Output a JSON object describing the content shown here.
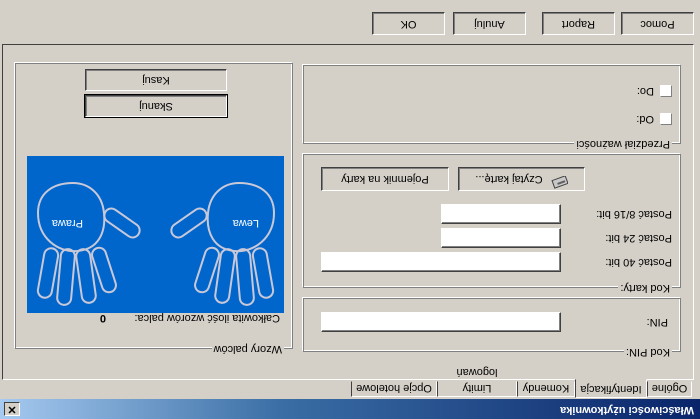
{
  "window": {
    "title": "Właściwości użytkownika",
    "close_glyph": "✕"
  },
  "tabs": [
    {
      "label": "Ogólne"
    },
    {
      "label": "Identyfikacja"
    },
    {
      "label": "Komendy"
    },
    {
      "label": "Limity logowań"
    },
    {
      "label": "Opcje hotelowe"
    }
  ],
  "active_tab": "Identyfikacja",
  "pin_group": {
    "label": "Kod PIN:",
    "pin_label": "PIN:",
    "pin_value": ""
  },
  "card_group": {
    "label": "Kod karty:",
    "bits40_label": "Postać 40 bit:",
    "bits24_label": "Postać 24 bit:",
    "bits816_label": "Postać 8/16 bit:",
    "bits40_value": "",
    "bits24_value": "",
    "bits816_value": "",
    "read_card_label": "Czytaj kartę...",
    "card_reader_label": "Pojemnik na karty",
    "read_card_icon": "card-reader-icon"
  },
  "validity_group": {
    "label": "Przedział ważności",
    "from_label": "Od:",
    "to_label": "Do:",
    "from_checked": false,
    "to_checked": false
  },
  "fingerprint_group": {
    "label": "Wzory palców",
    "count_label": "Całkowita ilość wzorów palca:",
    "count_value": "0",
    "left_hand_label": "Lewa",
    "right_hand_label": "Prawa",
    "scan_label": "Skanuj",
    "delete_label": "Kasuj",
    "hands_bg": "#0066cc"
  },
  "footer": {
    "help_label": "Pomoc",
    "report_label": "Raport",
    "cancel_label": "Anuluj",
    "ok_label": "OK"
  }
}
